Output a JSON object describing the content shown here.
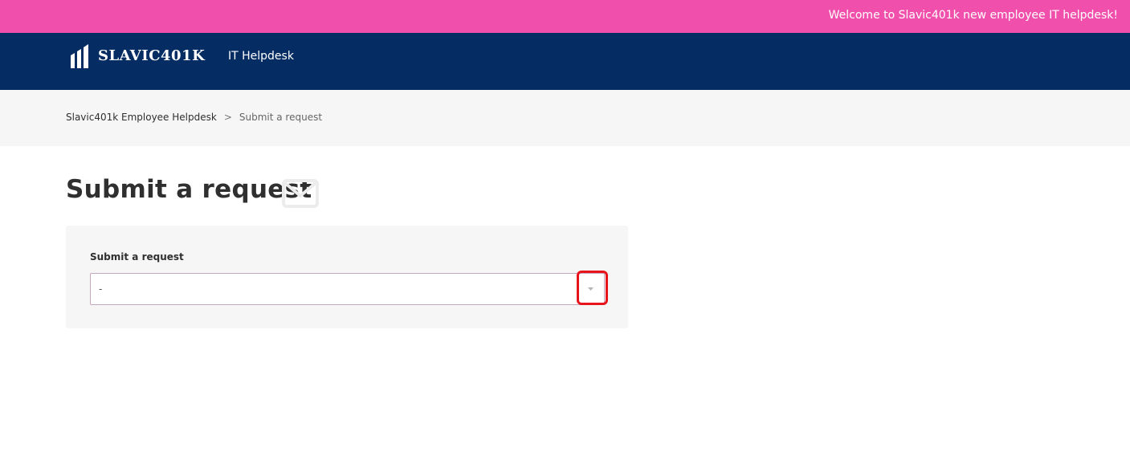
{
  "banner": {
    "text": "Welcome to Slavic401k new employee IT helpdesk!",
    "color": "#f050ab"
  },
  "header": {
    "logo_text": "SLAVIC401K",
    "title": "IT Helpdesk",
    "color": "#052d64"
  },
  "breadcrumb": {
    "home": "Slavic401k Employee Helpdesk",
    "separator": ">",
    "current": "Submit a request"
  },
  "page": {
    "title": "Submit a request",
    "title_icon": "envelope-icon"
  },
  "form": {
    "label": "Submit a request",
    "select_value": "-",
    "arrow_icon": "chevron-down-icon",
    "highlight_color": "#e8141c"
  }
}
